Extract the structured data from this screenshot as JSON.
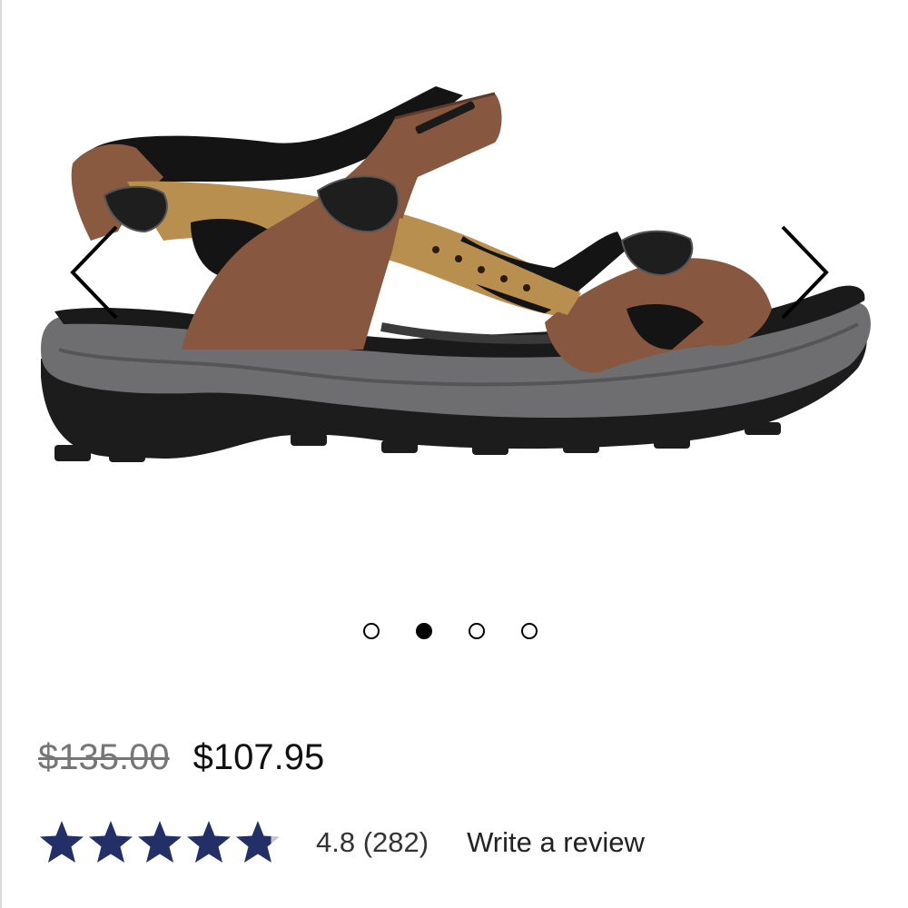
{
  "gallery": {
    "image_alt": "Brown and tan leather sport sandal with black straps and grey/black sole",
    "prev_icon": "chevron-left-icon",
    "next_icon": "chevron-right-icon",
    "slide_count": 4,
    "active_slide": 2
  },
  "pricing": {
    "original_price": "$135.00",
    "sale_price": "$107.95"
  },
  "rating": {
    "value": 4.8,
    "max": 5,
    "star_color": "#233067",
    "empty_star_color": "#c8c8c8",
    "text": "4.8 (282)",
    "review_link": "Write a review"
  }
}
